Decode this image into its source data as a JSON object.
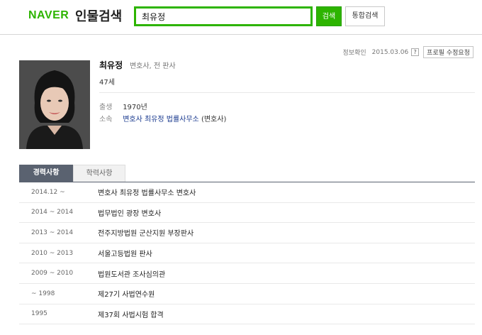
{
  "header": {
    "logo": "NAVER",
    "service": "인물검색",
    "search_value": "최유정",
    "search_button": "검색",
    "integrated_button": "통합검색"
  },
  "meta": {
    "info_label": "정보확인",
    "date": "2015.03.06",
    "help": "?",
    "edit_request": "프로필 수정요청"
  },
  "profile": {
    "name": "최유정",
    "occupation": "변호사, 전 판사",
    "age": "47세",
    "birth_label": "출생",
    "birth_value": "1970년",
    "affiliation_label": "소속",
    "affiliation_value": "변호사 최유정 법률사무소",
    "affiliation_suffix": "(변호사)"
  },
  "tabs": [
    {
      "label": "경력사항",
      "active": true
    },
    {
      "label": "학력사항",
      "active": false
    }
  ],
  "career": [
    {
      "period": "2014.12 ~",
      "desc": "변호사 최유정 법률사무소 변호사"
    },
    {
      "period": "2014 ~ 2014",
      "desc": "법무법인 광장 변호사"
    },
    {
      "period": "2013 ~ 2014",
      "desc": "전주지방법원 군산지원 부장판사"
    },
    {
      "period": "2010 ~ 2013",
      "desc": "서울고등법원 판사"
    },
    {
      "period": "2009 ~ 2010",
      "desc": "법원도서관 조사심의관"
    },
    {
      "period": "~ 1998",
      "desc": "제27기 사법연수원"
    },
    {
      "period": "1995",
      "desc": "제37회 사법시험 합격"
    }
  ],
  "colors": {
    "brand_green": "#2db400",
    "tab_active_bg": "#5a6270",
    "link_blue": "#1a3a8f"
  }
}
